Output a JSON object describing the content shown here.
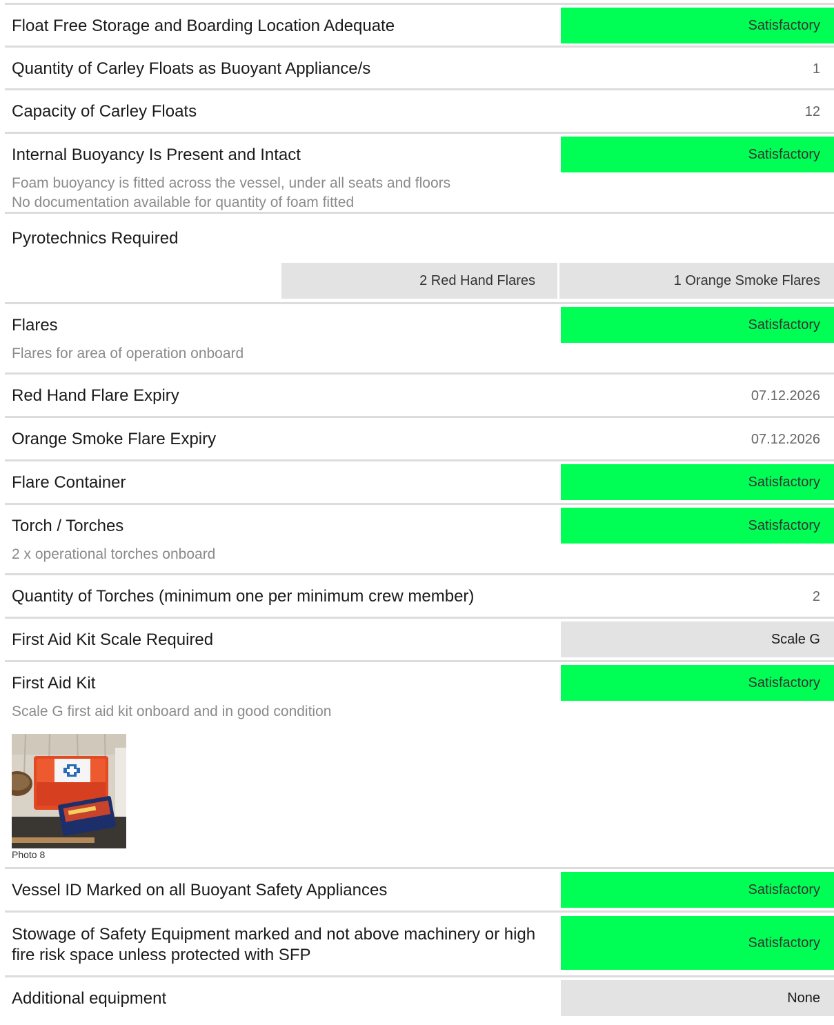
{
  "items": [
    {
      "label": "Float Free Storage and Boarding Location Adequate",
      "status": "Satisfactory"
    },
    {
      "label": "Quantity of Carley Floats as Buoyant Appliance/s",
      "value": "1"
    },
    {
      "label": "Capacity of Carley Floats",
      "value": "12"
    },
    {
      "label": "Internal Buoyancy Is Present and Intact",
      "status": "Satisfactory",
      "note_1": "Foam buoyancy is fitted across the vessel, under all seats and floors",
      "note_2": "No documentation available for quantity of foam fitted"
    },
    {
      "label": "Pyrotechnics Required",
      "cell_1": "2 Red Hand Flares",
      "cell_2": "1 Orange Smoke Flares"
    },
    {
      "label": "Flares",
      "status": "Satisfactory",
      "note_1": "Flares for area of operation onboard"
    },
    {
      "label": "Red Hand Flare Expiry",
      "value": "07.12.2026"
    },
    {
      "label": "Orange Smoke Flare Expiry",
      "value": "07.12.2026"
    },
    {
      "label": "Flare Container",
      "status": "Satisfactory"
    },
    {
      "label": "Torch / Torches",
      "status": "Satisfactory",
      "note_1": "2 x operational torches onboard"
    },
    {
      "label": "Quantity of Torches (minimum one per minimum crew member)",
      "value": "2"
    },
    {
      "label": "First Aid Kit Scale Required",
      "status": "Scale G"
    },
    {
      "label": "First Aid Kit",
      "status": "Satisfactory",
      "note_1": "Scale G first aid kit onboard and in good condition",
      "photo_caption": "Photo 8"
    },
    {
      "label": "Vessel ID Marked on all Buoyant Safety Appliances",
      "status": "Satisfactory"
    },
    {
      "label": "Stowage of Safety Equipment marked and not above machinery or high fire risk space unless protected with SFP",
      "status": "Satisfactory"
    },
    {
      "label": "Additional equipment",
      "status": "None"
    }
  ],
  "colors": {
    "satisfactory": "#00ff55",
    "neutral_cell": "#e3e3e3",
    "divider": "#dcdcdc",
    "note_text": "#8a8a8a"
  }
}
